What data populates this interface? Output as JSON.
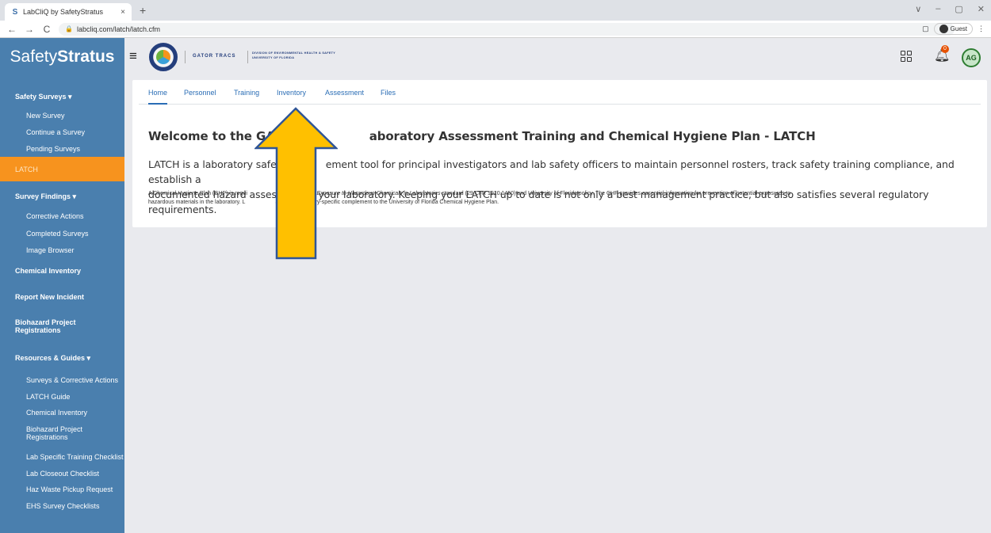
{
  "browser": {
    "tab_title": "LabCliQ by SafetyStratus",
    "tab_close": "×",
    "new_tab": "+",
    "url": "labcliq.com/latch/latch.cfm",
    "profile": "Guest",
    "controls": [
      "∨",
      "–",
      "▢",
      "✕"
    ]
  },
  "header": {
    "brand_light": "Safety",
    "brand_bold": "Stratus",
    "gator_traks": "GATOR TRACS",
    "division_line1": "DIVISION OF ENVIRONMENTAL HEALTH & SAFETY",
    "division_line2": "UNIVERSITY OF FLORIDA",
    "notification_count": "0",
    "avatar_initials": "AG"
  },
  "sidebar": {
    "safety_surveys": "Safety Surveys ▾",
    "new_survey": "New Survey",
    "continue_survey": "Continue a Survey",
    "pending_surveys": "Pending Surveys",
    "latch": "LATCH",
    "survey_findings": "Survey Findings ▾",
    "corrective_actions": "Corrective Actions",
    "completed_surveys": "Completed Surveys",
    "image_browser": "Image Browser",
    "chemical_inventory": "Chemical Inventory",
    "report_incident": "Report New Incident",
    "biohazard_line1": "Biohazard Project",
    "biohazard_line2": "Registrations",
    "resources": "Resources & Guides ▾",
    "res_surveys": "Surveys & Corrective Actions",
    "res_latch": "LATCH Guide",
    "res_chem": "Chemical Inventory",
    "res_bio1": "Biohazard Project",
    "res_bio2": "Registrations",
    "res_lab_training": "Lab Specific Training Checklist",
    "res_closeout": "Lab Closeout Checklist",
    "res_haz": "Haz Waste Pickup Request",
    "res_ehs": "EHS Survey Checklists"
  },
  "tabs": {
    "home": "Home",
    "personnel": "Personnel",
    "training": "Training",
    "inventory": "Inventory",
    "assessment": "Assessment",
    "files": "Files"
  },
  "main": {
    "welcome_a": "Welcome to the GAT",
    "welcome_b": "aboratory Assessment Training and Chemical Hygiene Plan - LATCH",
    "intro_l1a": "LATCH is a laboratory safety",
    "intro_l1b": "ement tool for principal investigators and lab safety officers to maintain personnel rosters, track safety training compliance, and establish a",
    "intro_l2a": "documented hazard assessm",
    "intro_l2b": "your laboratory. Keeping your LATCH up to date is not only a best management practice, but also satisfies several regulatory requirements.",
    "chp_l1a": "A Chemical Hygiene Plan (CHP) is requi",
    "chp_l1b_em": "'s Occupational Exposure to Hazardous Chemicals in Laboratories",
    "chp_l1c": " standard (29 CFR 1910.1450) and University of Florida policy. The CHP provides essential information for prevention of potential exposures to",
    "chp_l2a": "hazardous materials in the laboratory. L",
    "chp_l2b": "as your laboratory-specific complement to the University of Florida Chemical Hygiene Plan."
  },
  "colors": {
    "sidebar": "#4a7fae",
    "active": "#f7931e",
    "link": "#2a6db5",
    "arrow_fill": "#ffc000",
    "arrow_stroke": "#2f5597"
  }
}
